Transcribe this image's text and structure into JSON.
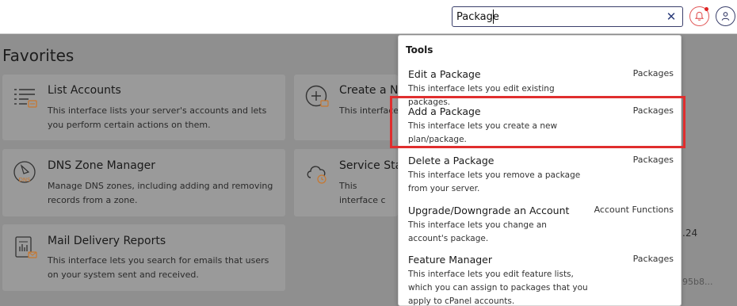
{
  "search": {
    "value": "Package",
    "clear_icon": "close-icon"
  },
  "header": {
    "notifications_icon": "bell-icon",
    "user_icon": "user-icon",
    "notification_dot_color": "#e02424"
  },
  "page": {
    "title": "Favorites",
    "cards": [
      {
        "icon": "list-accounts-icon",
        "title": "List Accounts",
        "description": "This interface lists your server's accounts and lets you perform certain actions on them."
      },
      {
        "icon": "add-circle-icon",
        "title": "Create a Ne",
        "description": "This interface"
      },
      {
        "icon": "dns-icon",
        "title": "DNS Zone Manager",
        "description": "Manage DNS zones, including adding and removing records from a zone."
      },
      {
        "icon": "cloud-clock-icon",
        "title": "Service Stat",
        "description": "This interface c services."
      },
      {
        "icon": "mail-report-icon",
        "title": "Mail Delivery Reports",
        "description": "This interface lets you search for emails that users on your system sent and received."
      }
    ],
    "fragments": [
      ".24",
      "95b8..."
    ]
  },
  "dropdown": {
    "heading": "Tools",
    "results": [
      {
        "title": "Edit a Package",
        "category": "Packages",
        "description": "This interface lets you edit existing packages."
      },
      {
        "title": "Add a Package",
        "category": "Packages",
        "description": "This interface lets you create a new plan/package."
      },
      {
        "title": "Delete a Package",
        "category": "Packages",
        "description": "This interface lets you remove a package from your server."
      },
      {
        "title": "Upgrade/Downgrade an Account",
        "category": "Account Functions",
        "description": "This interface lets you change an account's package."
      },
      {
        "title": "Feature Manager",
        "category": "Packages",
        "description": "This interface lets you edit feature lists, which you can assign to packages that you apply to cPanel accounts."
      }
    ]
  },
  "colors": {
    "highlight_border": "#e02e2e",
    "accent": "#e8853a",
    "dim_overlay": "#8f8f8f"
  }
}
